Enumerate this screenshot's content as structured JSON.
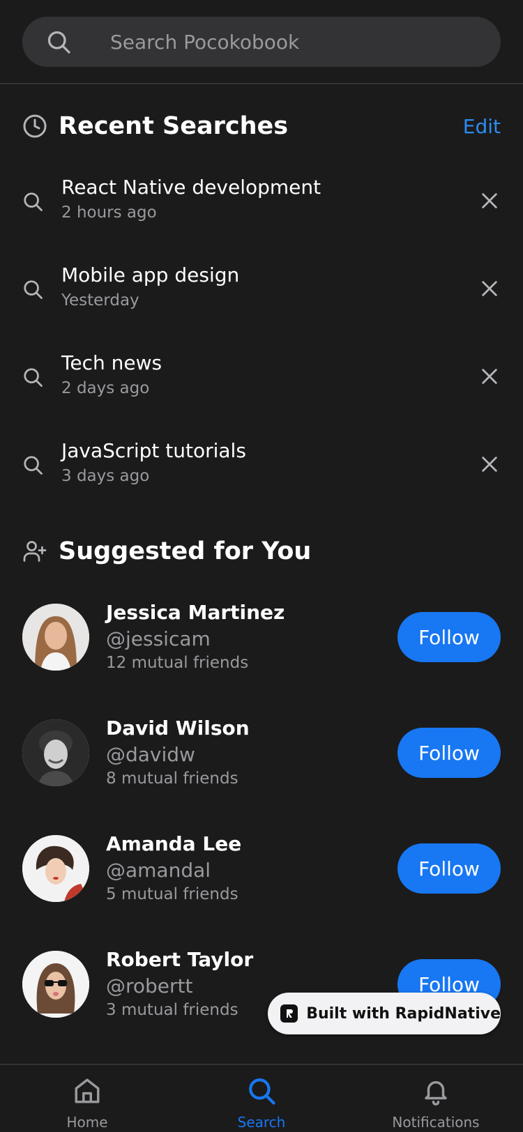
{
  "search": {
    "placeholder": "Search Pocokobook"
  },
  "recent": {
    "title": "Recent Searches",
    "edit_label": "Edit",
    "items": [
      {
        "query": "React Native development",
        "time": "2 hours ago"
      },
      {
        "query": "Mobile app design",
        "time": "Yesterday"
      },
      {
        "query": "Tech news",
        "time": "2 days ago"
      },
      {
        "query": "JavaScript tutorials",
        "time": "3 days ago"
      }
    ]
  },
  "suggested": {
    "title": "Suggested for You",
    "follow_label": "Follow",
    "users": [
      {
        "name": "Jessica Martinez",
        "handle": "@jessicam",
        "mutual": "12 mutual friends"
      },
      {
        "name": "David Wilson",
        "handle": "@davidw",
        "mutual": "8 mutual friends"
      },
      {
        "name": "Amanda Lee",
        "handle": "@amandal",
        "mutual": "5 mutual friends"
      },
      {
        "name": "Robert Taylor",
        "handle": "@robertt",
        "mutual": "3 mutual friends"
      }
    ]
  },
  "badge": {
    "label": "Built with RapidNative"
  },
  "tabs": [
    {
      "label": "Home",
      "icon": "home-icon",
      "active": false
    },
    {
      "label": "Search",
      "icon": "search-icon",
      "active": true
    },
    {
      "label": "Notifications",
      "icon": "bell-icon",
      "active": false
    }
  ],
  "colors": {
    "accent": "#1877f2",
    "link": "#2d8cf0",
    "background": "#1b1b1c"
  }
}
